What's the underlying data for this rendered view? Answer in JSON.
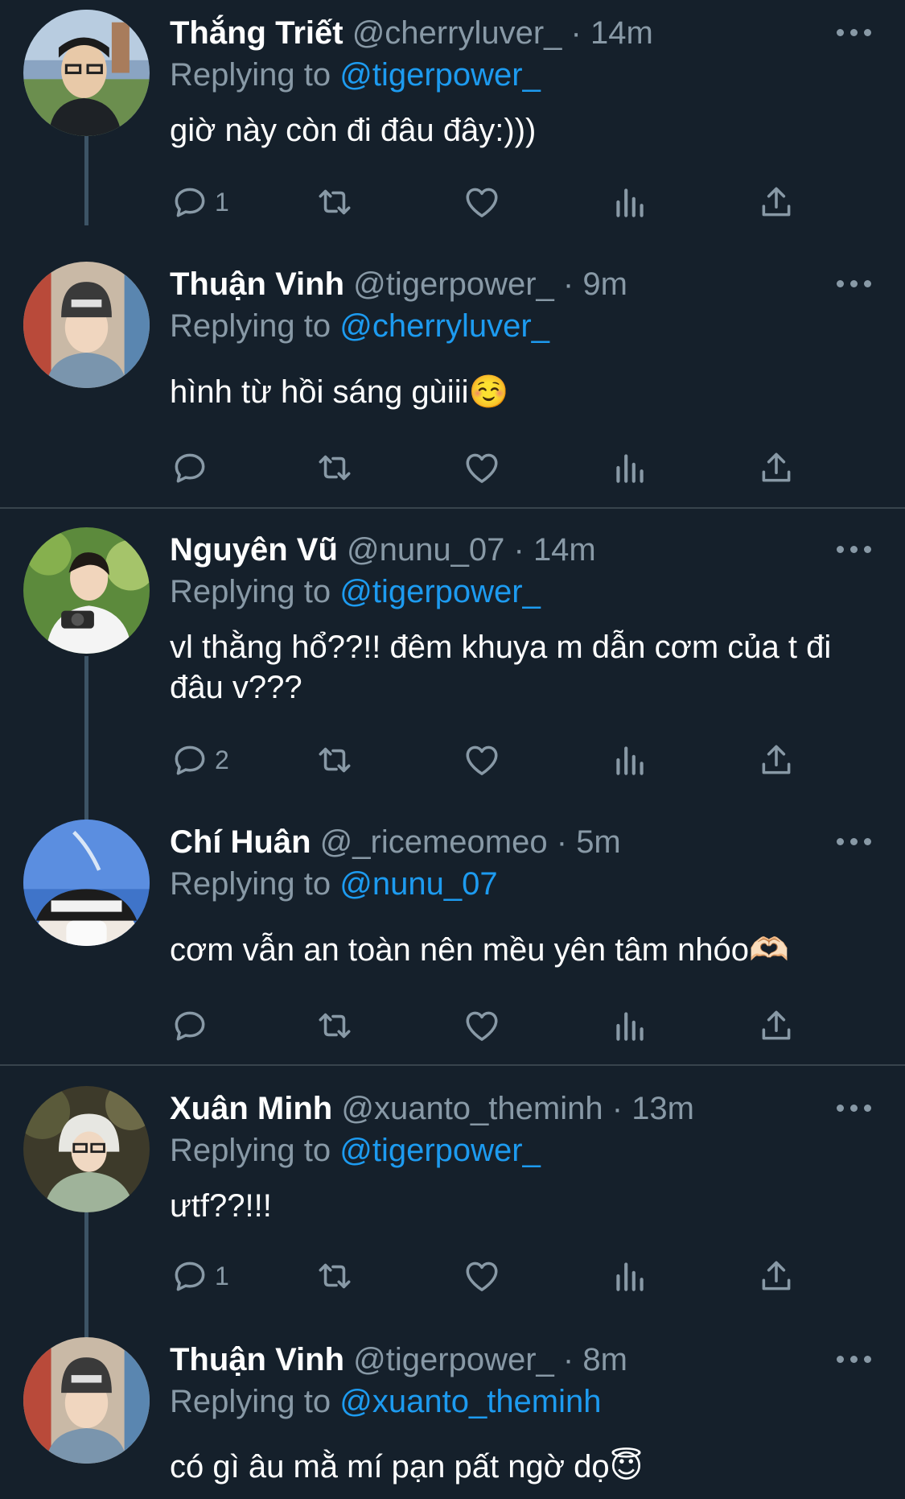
{
  "colors": {
    "background": "#15202b",
    "text_primary": "#ffffff",
    "text_secondary": "#8899a6",
    "link": "#1d9bf0",
    "thread_line": "#3d5466",
    "separator": "#38444d"
  },
  "replying_label": "Replying to",
  "tweets": [
    {
      "name": "Thắng Triết",
      "handle": "@cherryluver_",
      "sep": "·",
      "time": "14m",
      "reply_to": "@tigerpower_",
      "text": "giờ này còn đi đâu đây:)))",
      "reply_count": "1",
      "avatar_icon": "user-photo-glasses"
    },
    {
      "name": "Thuận Vinh",
      "handle": "@tigerpower_",
      "sep": "·",
      "time": "9m",
      "reply_to": "@cherryluver_",
      "text": "hình từ hồi sáng gùiii☺️",
      "reply_count": "",
      "avatar_icon": "user-photo-beanie"
    },
    {
      "name": "Nguyên Vũ",
      "handle": "@nunu_07",
      "sep": "·",
      "time": "14m",
      "reply_to": "@tigerpower_",
      "text": "vl thằng hổ??!! đêm khuya m dẫn cơm của t đi đâu v???",
      "reply_count": "2",
      "avatar_icon": "user-photo-camera"
    },
    {
      "name": "Chí Huân",
      "handle": "@_ricemeomeo",
      "sep": "·",
      "time": "5m",
      "reply_to": "@nunu_07",
      "text": "cơm vẫn an toàn nên mều yên tâm nhóo🫶🏻",
      "reply_count": "",
      "avatar_icon": "user-photo-sky"
    },
    {
      "name": "Xuân Minh",
      "handle": "@xuanto_theminh",
      "sep": "·",
      "time": "13m",
      "reply_to": "@tigerpower_",
      "text": "ưtf??!!!",
      "reply_count": "1",
      "avatar_icon": "user-photo-hood"
    },
    {
      "name": "Thuận Vinh",
      "handle": "@tigerpower_",
      "sep": "·",
      "time": "8m",
      "reply_to": "@xuanto_theminh",
      "text": "có gì âu mằ mí pạn pất ngờ dọ😇",
      "reply_count": "",
      "avatar_icon": "user-photo-beanie"
    }
  ]
}
